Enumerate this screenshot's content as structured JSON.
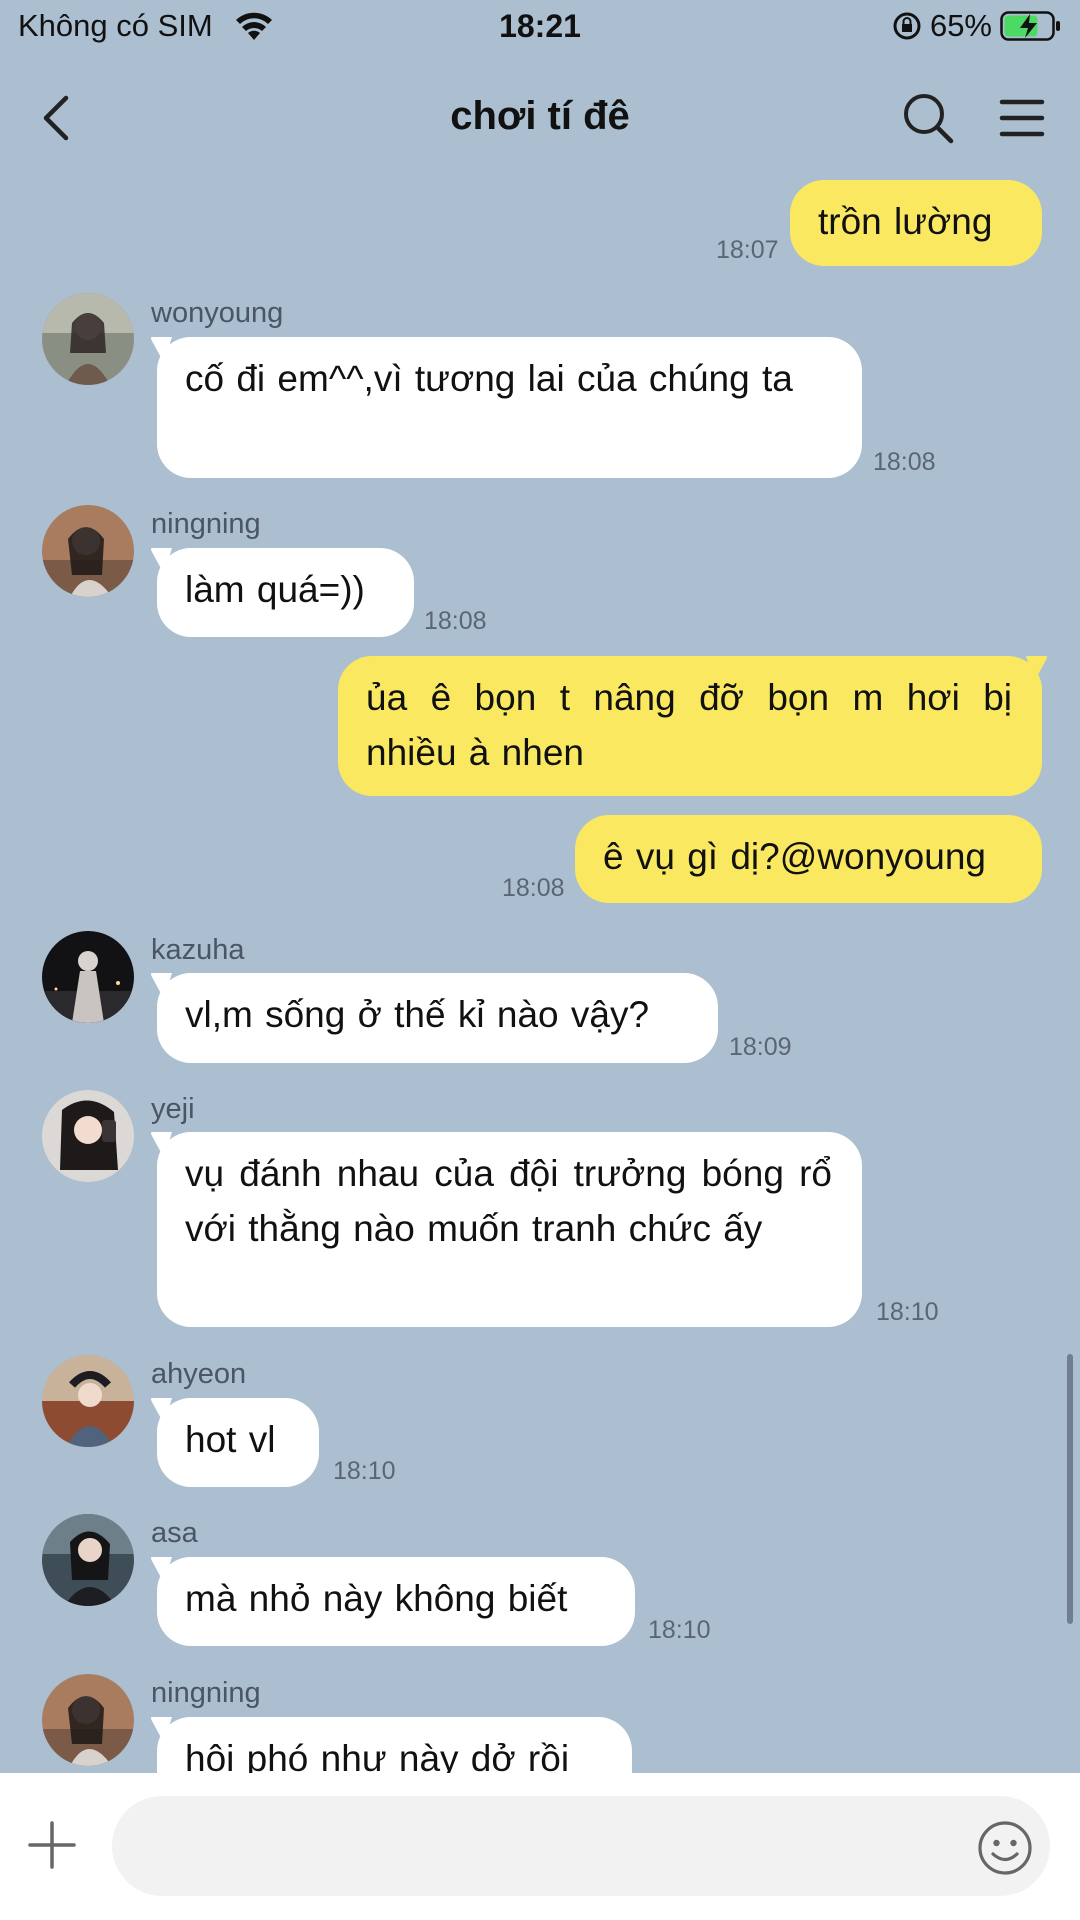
{
  "status_bar": {
    "carrier": "Không có SIM",
    "time": "18:21",
    "battery": "65%"
  },
  "header": {
    "title": "chơi tí đê",
    "back_icon": "chevron-left-icon",
    "search_icon": "search-icon",
    "menu_icon": "hamburger-menu-icon"
  },
  "messages": [
    {
      "side": "out",
      "text": "trồn lường",
      "time": "18:07"
    },
    {
      "side": "in",
      "sender": "wonyoung",
      "text": "cố đi em^^,vì tương lai của chúng ta",
      "time": "18:08"
    },
    {
      "side": "in",
      "sender": "ningning",
      "text": "làm quá=))",
      "time": "18:08"
    },
    {
      "side": "out",
      "text": "ủa ê bọn t nâng đỡ bọn m hơi bị nhiều à nhen",
      "time": ""
    },
    {
      "side": "out",
      "text": "ê vụ gì dị?@wonyoung",
      "time": "18:08"
    },
    {
      "side": "in",
      "sender": "kazuha",
      "text": "vl,m sống ở thế kỉ nào vậy?",
      "time": "18:09"
    },
    {
      "side": "in",
      "sender": "yeji",
      "text": "vụ đánh nhau của đội trưởng bóng rổ với thằng nào muốn tranh chức ấy",
      "time": "18:10"
    },
    {
      "side": "in",
      "sender": "ahyeon",
      "text": "hot vl",
      "time": "18:10"
    },
    {
      "side": "in",
      "sender": "asa",
      "text": "mà nhỏ này không biết",
      "time": "18:10"
    },
    {
      "side": "in",
      "sender": "ningning",
      "text": "hội phó như này dở rồi",
      "time": ""
    }
  ],
  "input": {
    "placeholder": "",
    "plus_icon": "plus-icon",
    "emoji_icon": "emoji-icon"
  },
  "colors": {
    "background": "#abbfd1",
    "outgoing_bubble": "#fae960",
    "incoming_bubble": "#ffffff"
  }
}
